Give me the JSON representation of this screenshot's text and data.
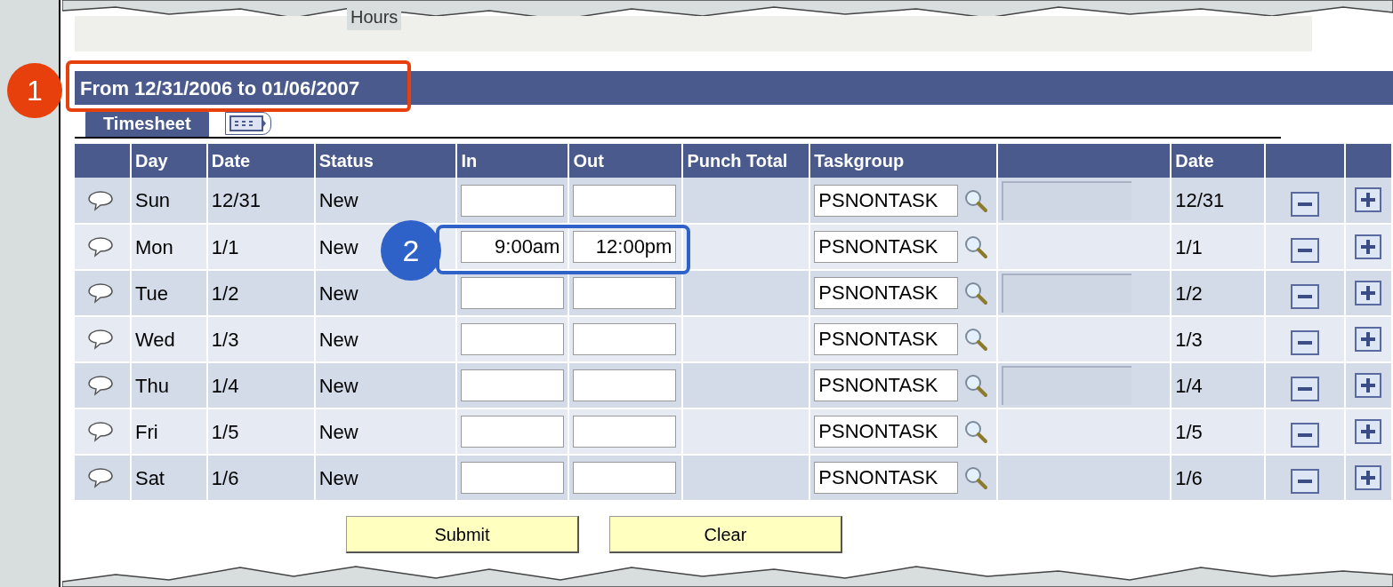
{
  "top_text": "Hours",
  "period_title": "From 12/31/2006 to 01/06/2007",
  "tabs": [
    {
      "kind": "text",
      "label": "Timesheet",
      "selected": true
    },
    {
      "kind": "icon",
      "selected": false
    }
  ],
  "columns": {
    "day": "Day",
    "date": "Date",
    "status": "Status",
    "in": "In",
    "out": "Out",
    "punch_total": "Punch Total",
    "taskgroup": "Taskgroup",
    "date_2": "Date"
  },
  "rows": [
    {
      "day": "Sun",
      "date": "12/31",
      "status": "New",
      "taskgroup": "PSNONTASK",
      "description_field": true,
      "date_2": "12/31"
    },
    {
      "day": "Mon",
      "date": "1/1",
      "status": "New",
      "in": "9:00am",
      "out": "12:00pm",
      "taskgroup": "PSNONTASK",
      "description_field": false,
      "date_2": "1/1"
    },
    {
      "day": "Tue",
      "date": "1/2",
      "status": "New",
      "taskgroup": "PSNONTASK",
      "description_field": true,
      "date_2": "1/2"
    },
    {
      "day": "Wed",
      "date": "1/3",
      "status": "New",
      "taskgroup": "PSNONTASK",
      "description_field": false,
      "date_2": "1/3"
    },
    {
      "day": "Thu",
      "date": "1/4",
      "status": "New",
      "taskgroup": "PSNONTASK",
      "description_field": true,
      "date_2": "1/4"
    },
    {
      "day": "Fri",
      "date": "1/5",
      "status": "New",
      "taskgroup": "PSNONTASK",
      "description_field": false,
      "date_2": "1/5"
    },
    {
      "day": "Sat",
      "date": "1/6",
      "status": "New",
      "taskgroup": "PSNONTASK",
      "description_field": false,
      "date_2": "1/6"
    }
  ],
  "buttons": [
    "Submit",
    "Clear"
  ],
  "callouts": [
    {
      "label": "1",
      "color": "#e8400c"
    },
    {
      "label": "2",
      "color": "#2f62c8"
    }
  ]
}
